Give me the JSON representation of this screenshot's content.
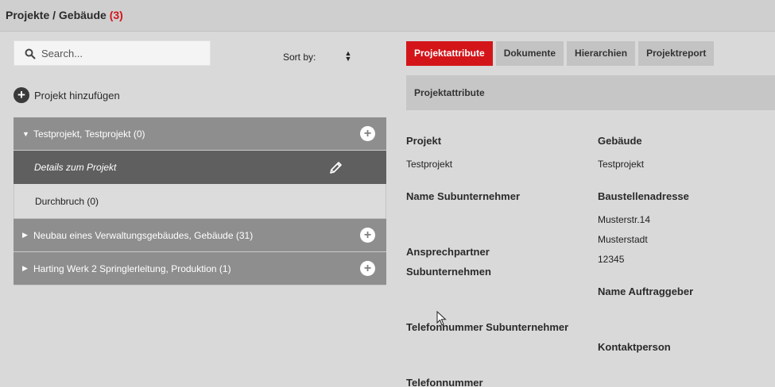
{
  "header": {
    "title": "Projekte / Gebäude",
    "count": "(3)"
  },
  "search": {
    "placeholder": "Search...",
    "icon": "search-icon"
  },
  "sort": {
    "label": "Sort by:",
    "icon": "sort-toggle-icon"
  },
  "add_project": {
    "label": "Projekt hinzufügen",
    "icon": "plus-circle-icon"
  },
  "tree": {
    "groups": [
      {
        "label": "Testprojekt, Testprojekt (0)",
        "expanded": true,
        "children": [
          {
            "label": "Details zum Projekt",
            "active": true,
            "icon": "pencil-icon"
          },
          {
            "label": "Durchbruch (0)",
            "active": false
          }
        ]
      },
      {
        "label": "Neubau eines Verwaltungsgebäudes, Gebäude (31)",
        "expanded": false
      },
      {
        "label": "Harting Werk 2 Springlerleitung, Produktion (1)",
        "expanded": false
      }
    ]
  },
  "tabs": [
    {
      "label": "Projektattribute",
      "active": true
    },
    {
      "label": "Dokumente",
      "active": false
    },
    {
      "label": "Hierarchien",
      "active": false
    },
    {
      "label": "Projektreport",
      "active": false
    }
  ],
  "section": {
    "title": "Projektattribute"
  },
  "attributes": {
    "projekt_label": "Projekt",
    "projekt_value": "Testprojekt",
    "gebaeude_label": "Gebäude",
    "gebaeude_value": "Testprojekt",
    "subunternehmer_label": "Name Subunternehmer",
    "baustelle_label": "Baustellenadresse",
    "baustelle_street": "Musterstr.14",
    "baustelle_city": "Musterstadt",
    "baustelle_zip": "12345",
    "ansprechpartner_label_1": "Ansprechpartner",
    "ansprechpartner_label_2": "Subunternehmen",
    "auftraggeber_label": "Name Auftraggeber",
    "telefon_sub_label": "Telefonnummer Subunternehmer",
    "kontakt_label": "Kontaktperson",
    "telefon_label": "Telefonnummer"
  },
  "colors": {
    "accent": "#d3151a",
    "group_row": "#8e8e8e",
    "active_row": "#5f5f5f",
    "background": "#d9d9d9"
  }
}
